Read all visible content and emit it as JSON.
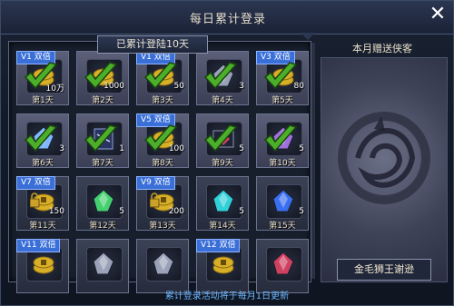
{
  "window": {
    "title": "每日累计登录",
    "close_icon": "close-icon"
  },
  "grid": {
    "title": "已累计登陆10天",
    "cells": [
      {
        "day": "第1天",
        "count": "10万",
        "badge": "V1 双倍",
        "claimed": true,
        "item": "gold-coins-icon",
        "color": "#d8b028"
      },
      {
        "day": "第2天",
        "count": "1000",
        "badge": "",
        "claimed": true,
        "item": "gold-coins-icon",
        "color": "#d8b028"
      },
      {
        "day": "第3天",
        "count": "50",
        "badge": "V1 双倍",
        "claimed": true,
        "item": "gold-coins-icon",
        "color": "#d8b028"
      },
      {
        "day": "第4天",
        "count": "3",
        "badge": "",
        "claimed": true,
        "item": "ore-crystal-icon",
        "color": "#9aa2b8"
      },
      {
        "day": "第5天",
        "count": "80",
        "badge": "V3 双倍",
        "claimed": true,
        "item": "gold-coins-icon",
        "color": "#d8b028"
      },
      {
        "day": "第6天",
        "count": "3",
        "badge": "",
        "claimed": true,
        "item": "blue-crystal-icon",
        "color": "#7fb8ff"
      },
      {
        "day": "第7天",
        "count": "1",
        "badge": "",
        "claimed": true,
        "item": "scroll-book-icon",
        "color": "#8ea0d8"
      },
      {
        "day": "第8天",
        "count": "100",
        "badge": "V5 双倍",
        "claimed": true,
        "item": "gold-coins-icon",
        "color": "#d8b028"
      },
      {
        "day": "第9天",
        "count": "5",
        "badge": "",
        "claimed": true,
        "item": "red-gem-box-icon",
        "color": "#d04060"
      },
      {
        "day": "第10天",
        "count": "5",
        "badge": "",
        "claimed": true,
        "item": "purple-crystal-icon",
        "color": "#a070e0"
      },
      {
        "day": "第11天",
        "count": "150",
        "badge": "V7 双倍",
        "claimed": false,
        "item": "gold-coins-lock-icon",
        "color": "#d8b028"
      },
      {
        "day": "第12天",
        "count": "5",
        "badge": "",
        "claimed": false,
        "item": "green-crystal-icon",
        "color": "#45d070"
      },
      {
        "day": "第13天",
        "count": "200",
        "badge": "V9 双倍",
        "claimed": false,
        "item": "gold-coins-lock-icon",
        "color": "#d8b028"
      },
      {
        "day": "第14天",
        "count": "5",
        "badge": "",
        "claimed": false,
        "item": "cyan-crystal-icon",
        "color": "#30d0d8"
      },
      {
        "day": "第15天",
        "count": "5",
        "badge": "",
        "claimed": false,
        "item": "blue-crystal-icon",
        "color": "#3a6ef0"
      },
      {
        "day": "",
        "count": "",
        "badge": "V11 双倍",
        "claimed": false,
        "item": "gold-coins-icon",
        "color": "#d8b028"
      },
      {
        "day": "",
        "count": "",
        "badge": "",
        "claimed": false,
        "item": "gray-ore-icon",
        "color": "#9aa2b8"
      },
      {
        "day": "",
        "count": "",
        "badge": "",
        "claimed": false,
        "item": "gray-ore-icon",
        "color": "#9aa2b8"
      },
      {
        "day": "",
        "count": "",
        "badge": "V12 双倍",
        "claimed": false,
        "item": "gold-coins-icon",
        "color": "#d8b028"
      },
      {
        "day": "",
        "count": "",
        "badge": "",
        "claimed": false,
        "item": "red-gem-icon",
        "color": "#d04060"
      }
    ]
  },
  "right": {
    "title": "本月赠送侠客",
    "hero_name": "金毛狮王谢逊",
    "emblem_icon": "dragon-emblem-icon"
  },
  "footer": {
    "text": "累计登录活动将于每月1日更新"
  },
  "colors": {
    "check": "#4caf2a",
    "badge": "#3a6fd8",
    "footer": "#6fb8ff"
  }
}
